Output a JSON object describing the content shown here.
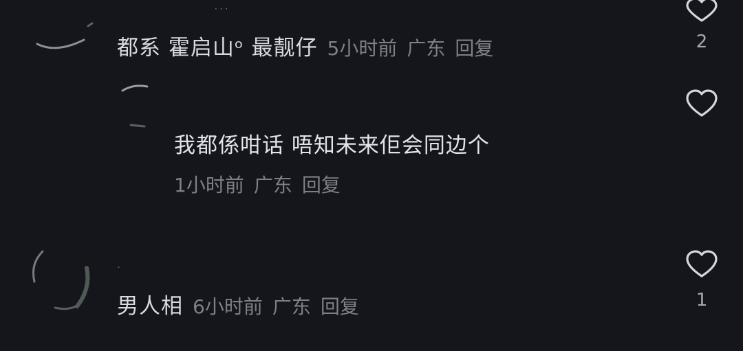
{
  "comments": [
    {
      "username": "都系 霍启山ᵒ 最靓仔",
      "time": "5小时前",
      "location": "广东",
      "reply_label": "回复",
      "like_count": "2"
    },
    {
      "text": "我都係咁话 唔知未来佢会同边个",
      "time": "1小时前",
      "location": "广东",
      "reply_label": "回复",
      "like_count": ""
    },
    {
      "username": "男人相",
      "time": "6小时前",
      "location": "广东",
      "reply_label": "回复",
      "like_count": "1"
    }
  ],
  "icons": {
    "like": "heart-outline-icon"
  },
  "colors": {
    "background": "#15161b",
    "username": "#d9dadf",
    "body_text": "#e4e5ea",
    "meta_text": "#7f8087",
    "icon": "#d6d7dc"
  }
}
